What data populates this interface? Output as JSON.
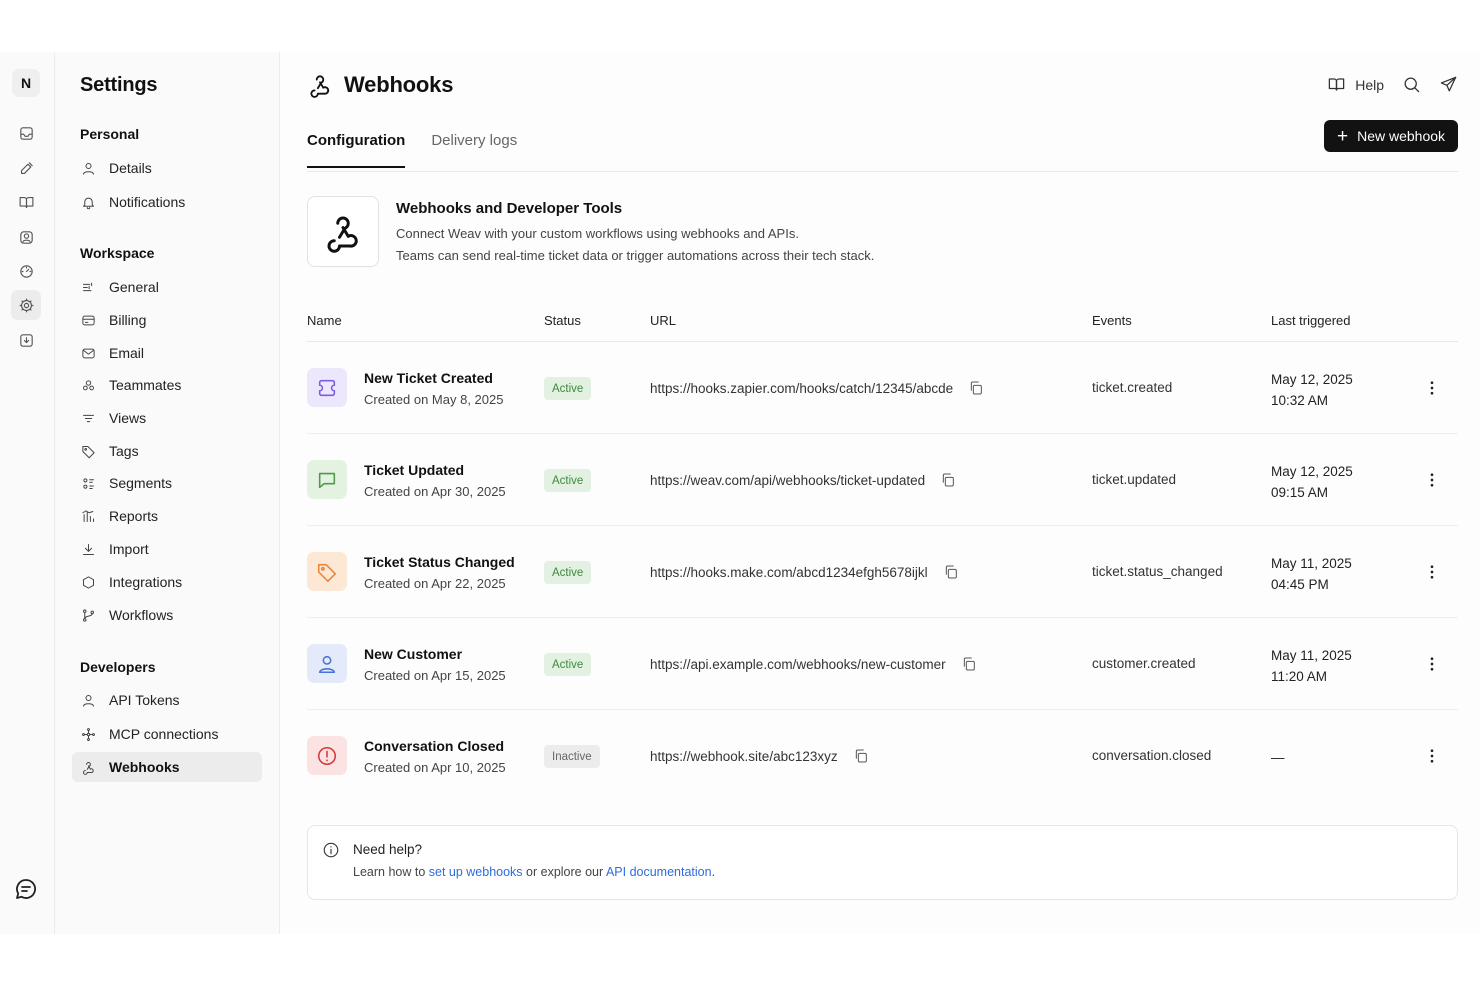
{
  "rail": {
    "logo_letter": "N",
    "icons": [
      "inbox-icon",
      "tools-icon",
      "book-icon",
      "contacts-icon",
      "dashboard-icon",
      "settings-icon",
      "import-icon"
    ],
    "active": "settings-icon",
    "bottom_icon": "chat-icon"
  },
  "sidebar": {
    "title": "Settings",
    "personal": {
      "heading": "Personal",
      "items": [
        {
          "label": "Details",
          "icon": "user-icon"
        },
        {
          "label": "Notifications",
          "icon": "bell-icon"
        }
      ]
    },
    "workspace": {
      "heading": "Workspace",
      "items": [
        {
          "label": "General",
          "icon": "sliders-icon"
        },
        {
          "label": "Billing",
          "icon": "billing-icon"
        },
        {
          "label": "Email",
          "icon": "mail-icon"
        },
        {
          "label": "Teammates",
          "icon": "teammates-icon"
        },
        {
          "label": "Views",
          "icon": "filter-icon"
        },
        {
          "label": "Tags",
          "icon": "tag-icon"
        },
        {
          "label": "Segments",
          "icon": "segments-icon"
        },
        {
          "label": "Reports",
          "icon": "reports-icon"
        },
        {
          "label": "Import",
          "icon": "download-icon"
        },
        {
          "label": "Integrations",
          "icon": "integrations-icon"
        },
        {
          "label": "Workflows",
          "icon": "workflow-icon"
        }
      ]
    },
    "developers": {
      "heading": "Developers",
      "items": [
        {
          "label": "API Tokens",
          "icon": "user-icon"
        },
        {
          "label": "MCP connections",
          "icon": "mcp-icon"
        },
        {
          "label": "Webhooks",
          "icon": "webhook-icon"
        }
      ]
    },
    "active_item": "Webhooks"
  },
  "header": {
    "title": "Webhooks",
    "help_label": "Help",
    "new_button_label": "New webhook"
  },
  "tabs": [
    {
      "label": "Configuration",
      "active": true
    },
    {
      "label": "Delivery logs",
      "active": false
    }
  ],
  "intro": {
    "title": "Webhooks and Developer Tools",
    "line1": "Connect Weav with your custom workflows using webhooks and APIs.",
    "line2": "Teams can send real-time ticket data or trigger automations across their tech stack."
  },
  "table": {
    "columns": [
      "Name",
      "Status",
      "URL",
      "Events",
      "Last triggered"
    ],
    "rows": [
      {
        "name": "New Ticket Created",
        "created": "Created on May 8, 2025",
        "status": "Active",
        "url": "https://hooks.zapier.com/hooks/catch/12345/abcde",
        "event": "ticket.created",
        "date": "May 12, 2025",
        "time": "10:32 AM",
        "icon": "ticket-icon",
        "color": "#7c5cdf",
        "bg": "#ece7fb"
      },
      {
        "name": "Ticket Updated",
        "created": "Created on Apr 30, 2025",
        "status": "Active",
        "url": "https://weav.com/api/webhooks/ticket-updated",
        "event": "ticket.updated",
        "date": "May 12, 2025",
        "time": "09:15 AM",
        "icon": "message-icon",
        "color": "#4e9a4a",
        "bg": "#e4f2e2"
      },
      {
        "name": "Ticket Status Changed",
        "created": "Created on Apr 22, 2025",
        "status": "Active",
        "url": "https://hooks.make.com/abcd1234efgh5678ijkl",
        "event": "ticket.status_changed",
        "date": "May 11, 2025",
        "time": "04:45 PM",
        "icon": "tag-icon",
        "color": "#e8873a",
        "bg": "#fde8d5"
      },
      {
        "name": "New Customer",
        "created": "Created on Apr 15, 2025",
        "status": "Active",
        "url": "https://api.example.com/webhooks/new-customer",
        "event": "customer.created",
        "date": "May 11, 2025",
        "time": "11:20 AM",
        "icon": "user-icon",
        "color": "#4a74d4",
        "bg": "#e3ebfa"
      },
      {
        "name": "Conversation Closed",
        "created": "Created on Apr 10, 2025",
        "status": "Inactive",
        "url": "https://webhook.site/abc123xyz",
        "event": "conversation.closed",
        "date": "—",
        "time": "",
        "icon": "alert-icon",
        "color": "#d93838",
        "bg": "#fbe3e3"
      }
    ]
  },
  "help_box": {
    "title": "Need help?",
    "text_before": "Learn how to ",
    "link1": "set up webhooks",
    "text_middle": " or explore our ",
    "link2": "API documentation",
    "text_after": "."
  }
}
